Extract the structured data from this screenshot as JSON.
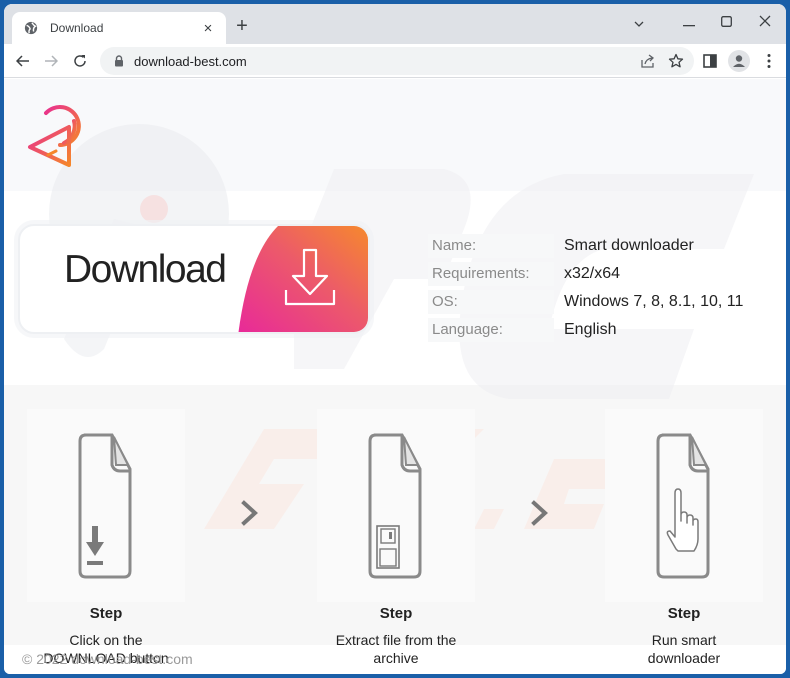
{
  "browser": {
    "tab_title": "Download",
    "tab_close": "×",
    "new_tab": "+",
    "url": "download-best.com",
    "window_controls": {
      "dropdown": "⌄",
      "minimize": "—",
      "maximize": "☐",
      "close": "✕"
    }
  },
  "page": {
    "download_button_label": "Download",
    "info": [
      {
        "key": "Name:",
        "value": "Smart downloader"
      },
      {
        "key": "Requirements:",
        "value": "x32/x64"
      },
      {
        "key": "OS:",
        "value": "Windows 7, 8, 8.1, 10, 11"
      },
      {
        "key": "Language:",
        "value": "English"
      }
    ],
    "steps": [
      {
        "title": "Step",
        "desc_line1": "Click on the",
        "desc_line2": "DOWNLOAD button",
        "icon": "file-download-icon"
      },
      {
        "title": "Step",
        "desc_line1": "Extract file from the",
        "desc_line2": "archive",
        "icon": "file-floppy-icon"
      },
      {
        "title": "Step",
        "desc_line1": "Run smart",
        "desc_line2": "downloader",
        "icon": "file-hand-icon"
      }
    ],
    "footer": "© 2022 download-best.com"
  },
  "colors": {
    "brand_pink": "#e8308f",
    "brand_orange": "#f5862a",
    "chrome_frame": "#1a5fa8"
  }
}
